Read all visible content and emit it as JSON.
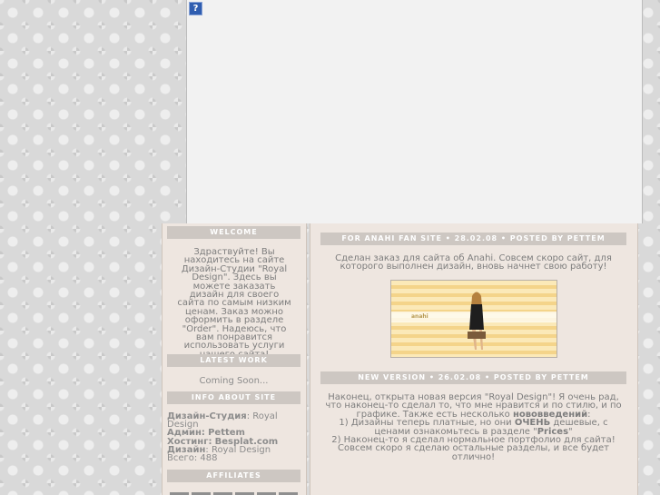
{
  "flash": {
    "help_icon_label": "?"
  },
  "sidebar": {
    "welcome_title": "Welcome",
    "welcome_text": "Здраствуйте! Вы находитесь на сайте Дизайн-Студии \"Royal Design\". Здесь вы можете заказать дизайн для своего сайта по самым низким ценам. Заказ можно оформить в разделе \"Order\". Надеюсь, что вам понравится использовать услуги нашего сайта!",
    "latest_work_title": "Latest Work",
    "latest_work_text": "Coming Soon...",
    "info_title": "Info About Site",
    "info": {
      "studio_label": "Дизайн-Студия",
      "studio_value": ": Royal Design",
      "admin_label": "Админ:",
      "admin_value": "Pettem",
      "hosting_label": "Хостинг:",
      "hosting_value": "Besplat.com",
      "design_label": "Дизайн",
      "design_value": ": Royal Design",
      "total_text": "Всего: 488"
    },
    "affiliates_title": "Affiliates"
  },
  "posts": [
    {
      "title": "For Anahi Fan Site • 28.02.08 • Posted by Pettem",
      "body": "Сделан заказ для сайта об Anahi. Совсем скоро сайт, для которого выполнен дизайн, вновь начнет свою работу!"
    },
    {
      "title": "New Version • 26.02.08 • Posted by Pettem",
      "p1": "Наконец, открыта новая версия \"Royal Design\"! Я очень рад, что наконец-то сделал то, что мне нравится и по стилю, и по графике. Также есть несколько ",
      "p1_bold": "нововведений",
      "p1_end": ":",
      "p2": "1) Дизайны теперь платные, но они ",
      "p2_bold": "ОЧЕНЬ",
      "p2_end": " дешевые, с ценами ознакомьтесь в разделе \"",
      "p2_bold2": "Prices",
      "p2_end2": "\"",
      "p3": "2) Наконец-то я сделал нормальное портфолио для сайта! Совсем скоро я сделаю остальные разделы, и все будет отлично!"
    }
  ],
  "banner": {
    "logo_text": "anahi"
  },
  "colors": {
    "title_bg": "#cdc7c2",
    "panel_bg": "#eee6e0",
    "text": "#7d7d7d"
  }
}
